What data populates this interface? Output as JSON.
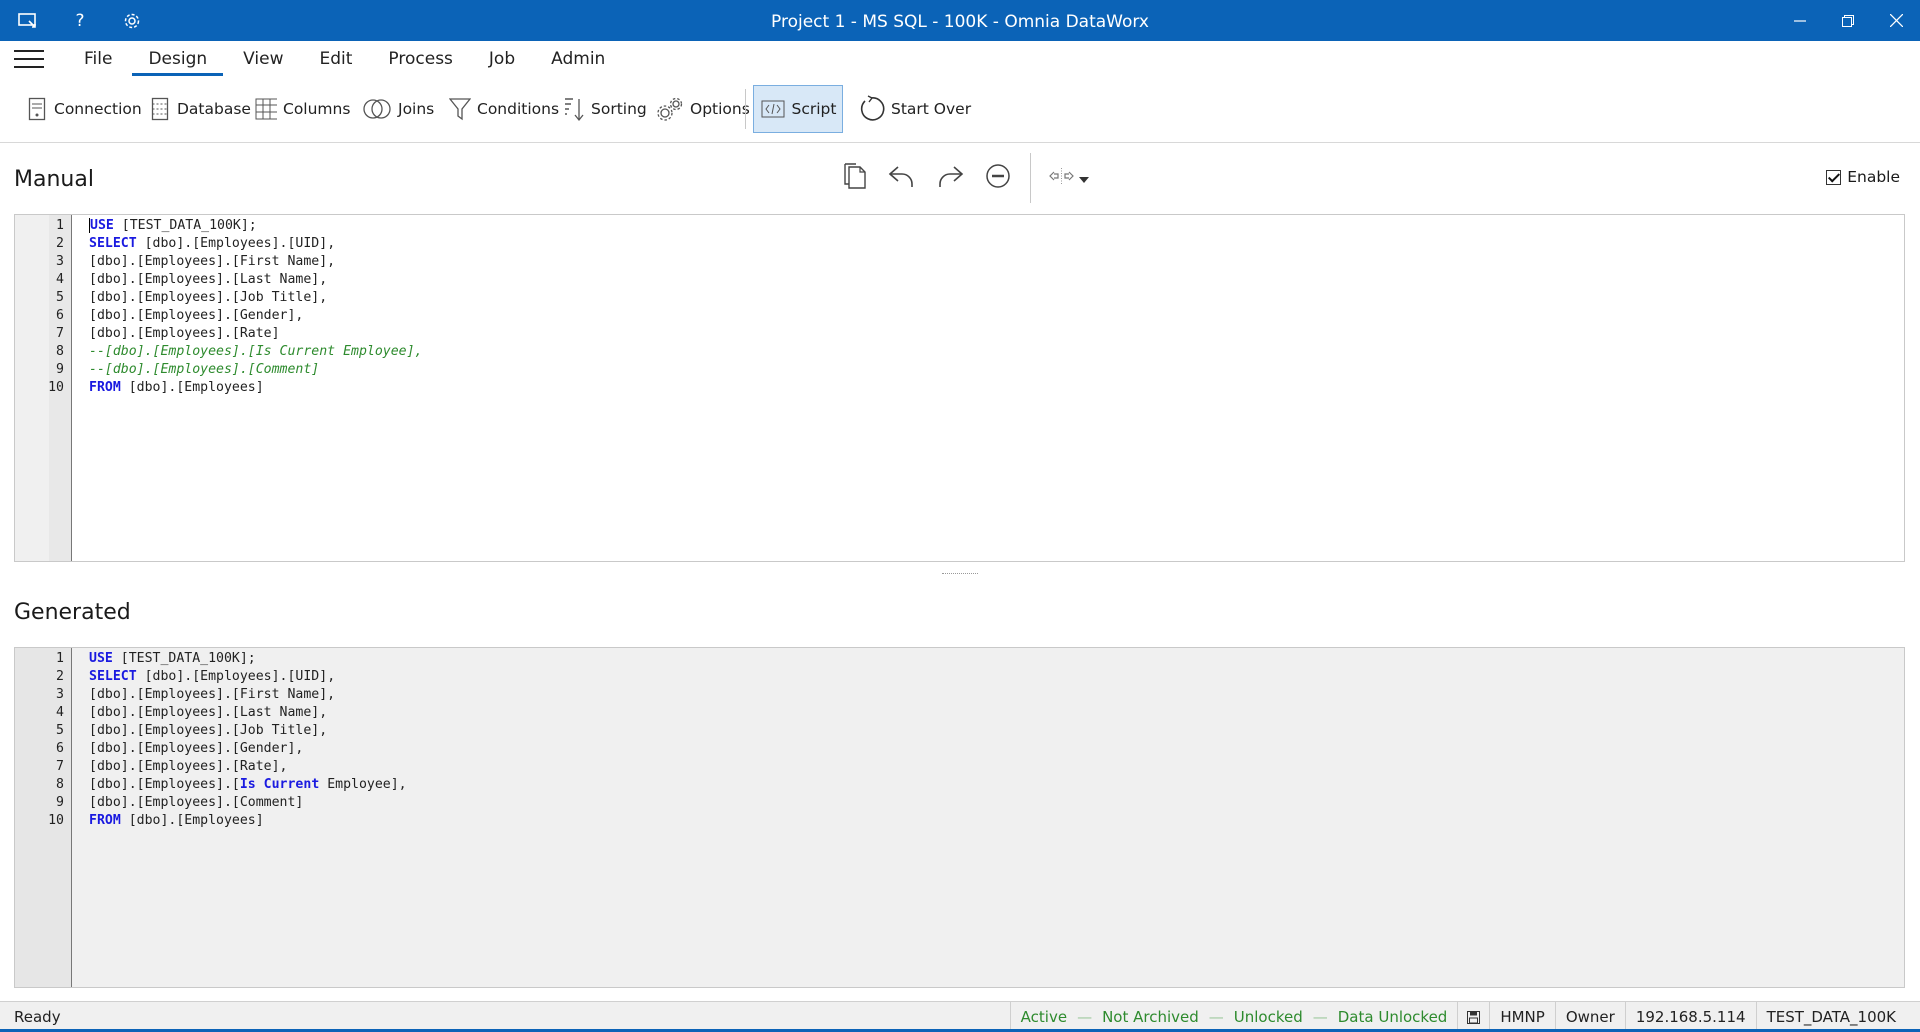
{
  "window": {
    "title": "Project 1 - MS SQL - 100K - Omnia DataWorx"
  },
  "menu": {
    "items": [
      "File",
      "Design",
      "View",
      "Edit",
      "Process",
      "Job",
      "Admin"
    ],
    "active": "Design"
  },
  "toolbar": {
    "connection": "Connection",
    "database": "Database",
    "columns": "Columns",
    "joins": "Joins",
    "conditions": "Conditions",
    "sorting": "Sorting",
    "options": "Options",
    "script": "Script",
    "start_over": "Start Over"
  },
  "manual": {
    "title": "Manual",
    "enable_label": "Enable",
    "enable_checked": true,
    "lines": [
      {
        "n": "1",
        "tokens": [
          {
            "t": "USE",
            "k": "kw"
          },
          {
            "t": " [TEST_DATA_100K];",
            "k": ""
          }
        ]
      },
      {
        "n": "2",
        "tokens": [
          {
            "t": "SELECT",
            "k": "kw"
          },
          {
            "t": " [dbo].[Employees].[UID],",
            "k": ""
          }
        ]
      },
      {
        "n": "3",
        "tokens": [
          {
            "t": "[dbo].[Employees].[First Name],",
            "k": ""
          }
        ]
      },
      {
        "n": "4",
        "tokens": [
          {
            "t": "[dbo].[Employees].[Last Name],",
            "k": ""
          }
        ]
      },
      {
        "n": "5",
        "tokens": [
          {
            "t": "[dbo].[Employees].[Job Title],",
            "k": ""
          }
        ]
      },
      {
        "n": "6",
        "tokens": [
          {
            "t": "[dbo].[Employees].[Gender],",
            "k": ""
          }
        ]
      },
      {
        "n": "7",
        "tokens": [
          {
            "t": "[dbo].[Employees].[Rate]",
            "k": ""
          }
        ]
      },
      {
        "n": "8",
        "tokens": [
          {
            "t": "--[dbo].[Employees].[Is Current Employee],",
            "k": "cm"
          }
        ]
      },
      {
        "n": "9",
        "tokens": [
          {
            "t": "--[dbo].[Employees].[Comment]",
            "k": "cm"
          }
        ]
      },
      {
        "n": "10",
        "tokens": [
          {
            "t": "FROM",
            "k": "kw"
          },
          {
            "t": " [dbo].[Employees]",
            "k": ""
          }
        ]
      }
    ]
  },
  "generated": {
    "title": "Generated",
    "lines": [
      {
        "n": "1",
        "tokens": [
          {
            "t": "USE",
            "k": "kw"
          },
          {
            "t": " [TEST_DATA_100K];",
            "k": ""
          }
        ]
      },
      {
        "n": "2",
        "tokens": [
          {
            "t": "SELECT",
            "k": "kw"
          },
          {
            "t": " [dbo].[Employees].[UID],",
            "k": ""
          }
        ]
      },
      {
        "n": "3",
        "tokens": [
          {
            "t": "[dbo].[Employees].[First Name],",
            "k": ""
          }
        ]
      },
      {
        "n": "4",
        "tokens": [
          {
            "t": "[dbo].[Employees].[Last Name],",
            "k": ""
          }
        ]
      },
      {
        "n": "5",
        "tokens": [
          {
            "t": "[dbo].[Employees].[Job Title],",
            "k": ""
          }
        ]
      },
      {
        "n": "6",
        "tokens": [
          {
            "t": "[dbo].[Employees].[Gender],",
            "k": ""
          }
        ]
      },
      {
        "n": "7",
        "tokens": [
          {
            "t": "[dbo].[Employees].[Rate],",
            "k": ""
          }
        ]
      },
      {
        "n": "8",
        "tokens": [
          {
            "t": "[dbo].[Employees].[",
            "k": ""
          },
          {
            "t": "Is Current",
            "k": "kw"
          },
          {
            "t": " Employee],",
            "k": ""
          }
        ]
      },
      {
        "n": "9",
        "tokens": [
          {
            "t": "[dbo].[Employees].[Comment]",
            "k": ""
          }
        ]
      },
      {
        "n": "10",
        "tokens": [
          {
            "t": "FROM",
            "k": "kw"
          },
          {
            "t": " [dbo].[Employees]",
            "k": ""
          }
        ]
      }
    ]
  },
  "status": {
    "ready": "Ready",
    "active": "Active",
    "archived": "Not Archived",
    "locked": "Unlocked",
    "data_locked": "Data Unlocked",
    "user": "HMNP",
    "role": "Owner",
    "ip": "192.168.5.114",
    "database": "TEST_DATA_100K"
  },
  "colors": {
    "titlebar": "#0b63b7",
    "keyword": "#1a1ae0",
    "comment": "#2e8b2e",
    "status_green": "#2e8b2e"
  }
}
